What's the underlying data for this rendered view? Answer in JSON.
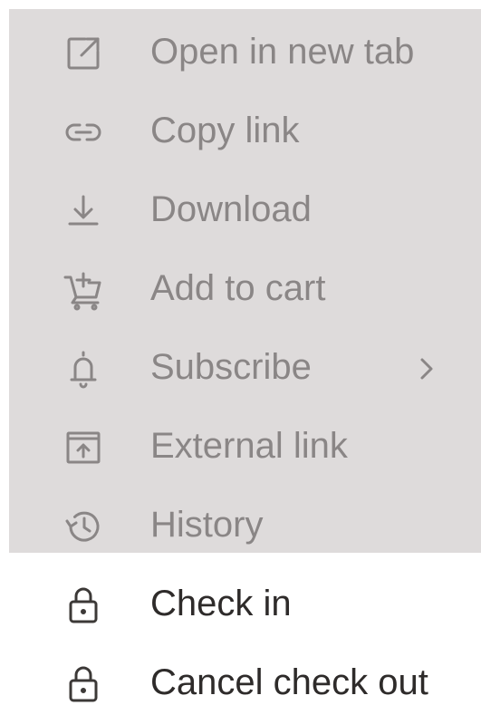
{
  "menu": {
    "items": [
      {
        "label": "Open in new tab",
        "icon": "open-in-new-tab-icon",
        "state": "disabled"
      },
      {
        "label": "Copy link",
        "icon": "link-icon",
        "state": "disabled"
      },
      {
        "label": "Download",
        "icon": "download-icon",
        "state": "disabled"
      },
      {
        "label": "Add to cart",
        "icon": "cart-add-icon",
        "state": "disabled"
      },
      {
        "label": "Subscribe",
        "icon": "bell-icon",
        "state": "disabled",
        "has_submenu": true
      },
      {
        "label": "External link",
        "icon": "external-link-icon",
        "state": "disabled"
      },
      {
        "label": "History",
        "icon": "history-icon",
        "state": "disabled"
      },
      {
        "label": "Check in",
        "icon": "lock-icon",
        "state": "enabled"
      },
      {
        "label": "Cancel check out",
        "icon": "lock-icon",
        "state": "enabled"
      }
    ]
  },
  "colors": {
    "disabled_background": "#dedbdb",
    "disabled_text": "#8a8686",
    "enabled_text": "#2e2b2a",
    "menu_background": "#ffffff"
  }
}
